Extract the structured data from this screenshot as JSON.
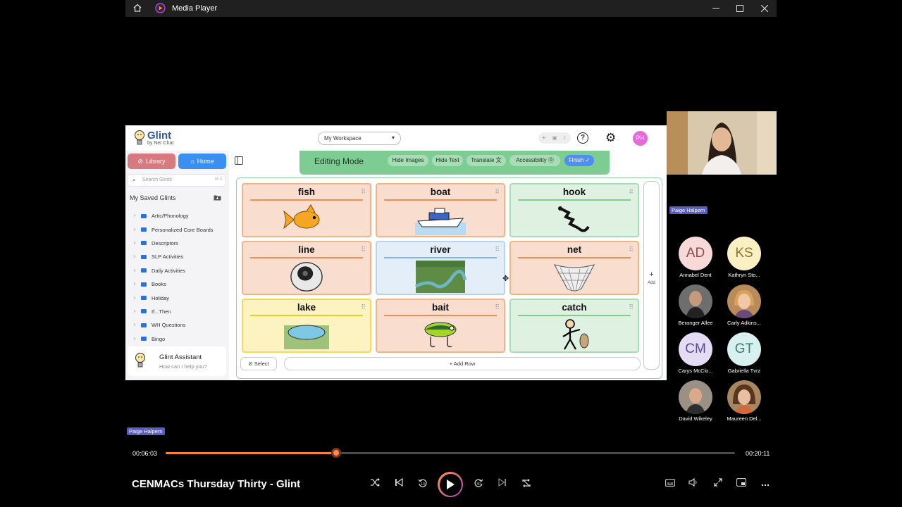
{
  "window": {
    "title": "Media Player"
  },
  "glint": {
    "brand": "Glint",
    "tagline": "by Ner Chat",
    "workspace": "My Workspace",
    "avatar_initials": "PH",
    "toggle_opts": [
      "☀",
      "▣",
      "☾"
    ]
  },
  "sidebar": {
    "library": "Library",
    "home": "Home",
    "search_placeholder": "Search Glints",
    "search_kbd": "⌘ K",
    "saved_title": "My Saved Glints",
    "folders": [
      "Artic/Phonology",
      "Personalized Core Boards",
      "Descriptors",
      "SLP Activities",
      "Daily Activities",
      "Books",
      "Holiday",
      "If...Then",
      "WH Questions",
      "Bingo"
    ],
    "assistant_title": "Glint Assistant",
    "assistant_sub": "How can I help you?"
  },
  "editbar": {
    "mode": "Editing Mode",
    "hide_images": "Hide Images",
    "hide_text": "Hide Text",
    "translate": "Translate",
    "accessibility": "Accessibility",
    "finish": "Finish"
  },
  "board": {
    "tiles": [
      {
        "word": "fish",
        "color": "#f9ddce",
        "icon": "goldfish-icon"
      },
      {
        "word": "boat",
        "color": "#f9ddce",
        "icon": "boat-icon"
      },
      {
        "word": "hook",
        "color": "#dff1e1",
        "icon": "hook-icon"
      },
      {
        "word": "line",
        "color": "#f9ddce",
        "icon": "fishing-line-spool-icon"
      },
      {
        "word": "river",
        "color": "#e3eef8",
        "icon": "river-photo"
      },
      {
        "word": "net",
        "color": "#f9ddce",
        "icon": "net-icon"
      },
      {
        "word": "lake",
        "color": "#fcf3c0",
        "icon": "lake-icon"
      },
      {
        "word": "bait",
        "color": "#f9ddce",
        "icon": "fishing-lure-icon"
      },
      {
        "word": "catch",
        "color": "#dff1e1",
        "icon": "person-catching-fish-icon"
      }
    ],
    "add_col": "Add",
    "select": "Select",
    "add_row": "Add Row"
  },
  "participants": {
    "presenter": "Paige Halpern",
    "list": [
      {
        "initials": "AD",
        "name": "Annabel Dent",
        "bg": "#f7d9d8",
        "fg": "#8a4d4a"
      },
      {
        "initials": "KS",
        "name": "Kathryn Sto...",
        "bg": "#fbefc4",
        "fg": "#8a7630"
      },
      {
        "initials": "",
        "name": "Beranger Allee",
        "bg": "#5b5b5b",
        "fg": "#fff"
      },
      {
        "initials": "",
        "name": "Carly Adkins...",
        "bg": "#c49a72",
        "fg": "#fff"
      },
      {
        "initials": "CM",
        "name": "Carys McClo...",
        "bg": "#e4dcf5",
        "fg": "#5b4a8a"
      },
      {
        "initials": "GT",
        "name": "Gabriella Tvrz",
        "bg": "#d8f0ef",
        "fg": "#3c7a77"
      },
      {
        "initials": "",
        "name": "David Wikeley",
        "bg": "#8d8377",
        "fg": "#fff"
      },
      {
        "initials": "",
        "name": "Maureen Del...",
        "bg": "#a8865f",
        "fg": "#fff"
      }
    ]
  },
  "player": {
    "title": "CENMACs Thursday Thirty - Glint",
    "current_time": "00:06:03",
    "total_time": "00:20:11",
    "progress": 0.3,
    "accent": "#ff7f45"
  }
}
